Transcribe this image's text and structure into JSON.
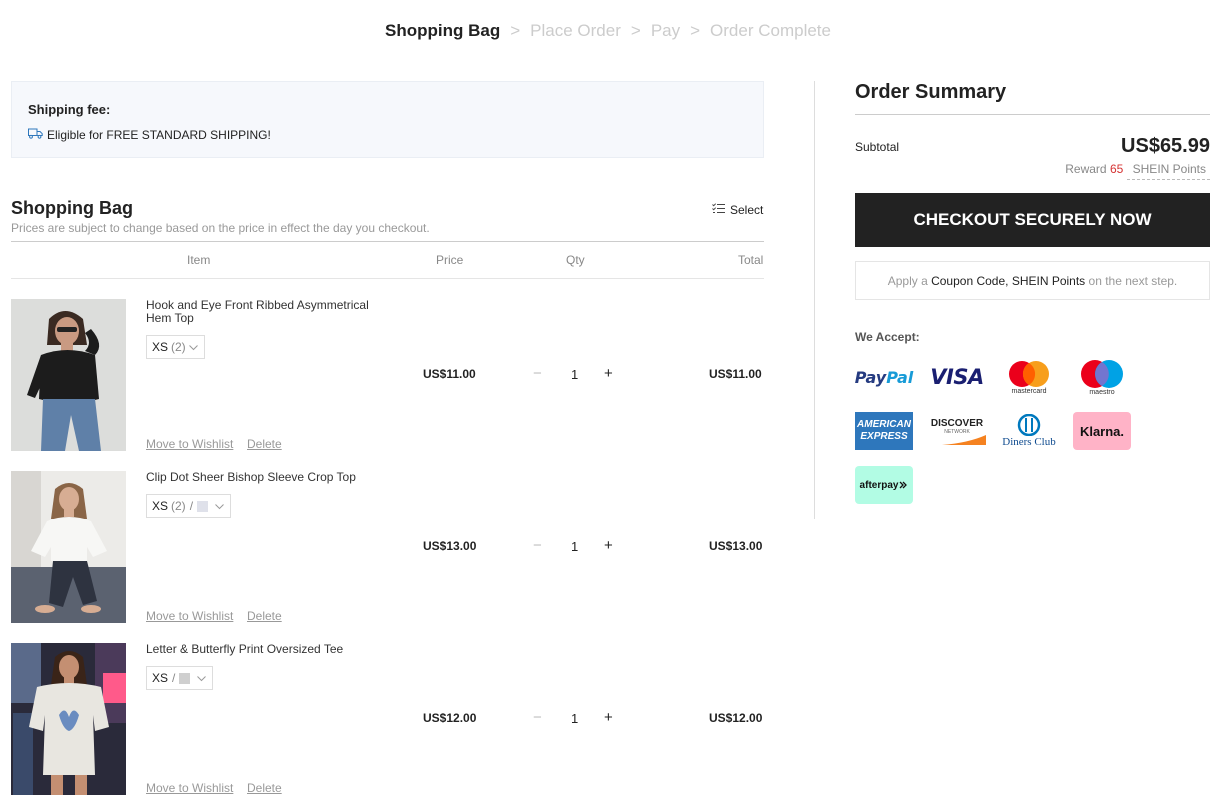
{
  "steps": {
    "shopping_bag": "Shopping Bag",
    "place_order": "Place Order",
    "pay": "Pay",
    "order_complete": "Order Complete",
    "separator": ">"
  },
  "shipping": {
    "title": "Shipping fee:",
    "message": "Eligible for FREE STANDARD SHIPPING!"
  },
  "bag": {
    "title": "Shopping Bag",
    "note": "Prices are subject to change based on the price in effect the day you checkout.",
    "select_label": "Select",
    "columns": {
      "item": "Item",
      "price": "Price",
      "qty": "Qty",
      "total": "Total"
    }
  },
  "items": [
    {
      "name": "Hook and Eye Front Ribbed Asymmetrical Hem Top",
      "size": "XS",
      "count": "(2)",
      "price": "US$11.00",
      "qty": "1",
      "total": "US$11.00",
      "wishlist": "Move to Wishlist",
      "delete": "Delete"
    },
    {
      "name": "Clip Dot Sheer Bishop Sleeve Crop Top",
      "size": "XS",
      "count": "(2)",
      "slash": "/",
      "swatch_color": "#dfe1ea",
      "price": "US$13.00",
      "qty": "1",
      "total": "US$13.00",
      "wishlist": "Move to Wishlist",
      "delete": "Delete"
    },
    {
      "name": "Letter & Butterfly Print Oversized Tee",
      "size": "XS",
      "slash": "/",
      "swatch_color": "#cfcfcf",
      "price": "US$12.00",
      "qty": "1",
      "total": "US$12.00",
      "wishlist": "Move to Wishlist",
      "delete": "Delete"
    }
  ],
  "qty_controls": {
    "minus": "−",
    "plus": "+"
  },
  "summary": {
    "title": "Order Summary",
    "subtotal_label": "Subtotal",
    "subtotal_value": "US$65.99",
    "reward_prefix": "Reward",
    "reward_points": "65",
    "reward_brand": "SHEIN Points",
    "checkout_label": "CHECKOUT SECURELY NOW",
    "coupon_prefix": "Apply a",
    "coupon_highlight": "Coupon Code, SHEIN Points",
    "coupon_suffix": "on the next step.",
    "we_accept": "We Accept:"
  },
  "payments": {
    "paypal": {
      "pay": "Pay",
      "pal": "Pal"
    },
    "visa": "VISA",
    "mastercard": "mastercard",
    "maestro": "maestro",
    "amex": {
      "line1": "AMERICAN",
      "line2": "EXPRESS"
    },
    "discover": {
      "name": "DISCOVER",
      "sub": "NETWORK"
    },
    "diners": "Diners Club",
    "klarna": "Klarna.",
    "afterpay": "afterpay"
  },
  "colors": {
    "checkout_bg": "#222222",
    "reward_points": "#d53333",
    "paypal_dark": "#253b80",
    "paypal_light": "#179bd7",
    "visa_blue": "#1a1f71",
    "klarna_pink": "#ffb3c7",
    "afterpay_mint": "#b2fce4",
    "amex_blue": "#2e77bc"
  }
}
